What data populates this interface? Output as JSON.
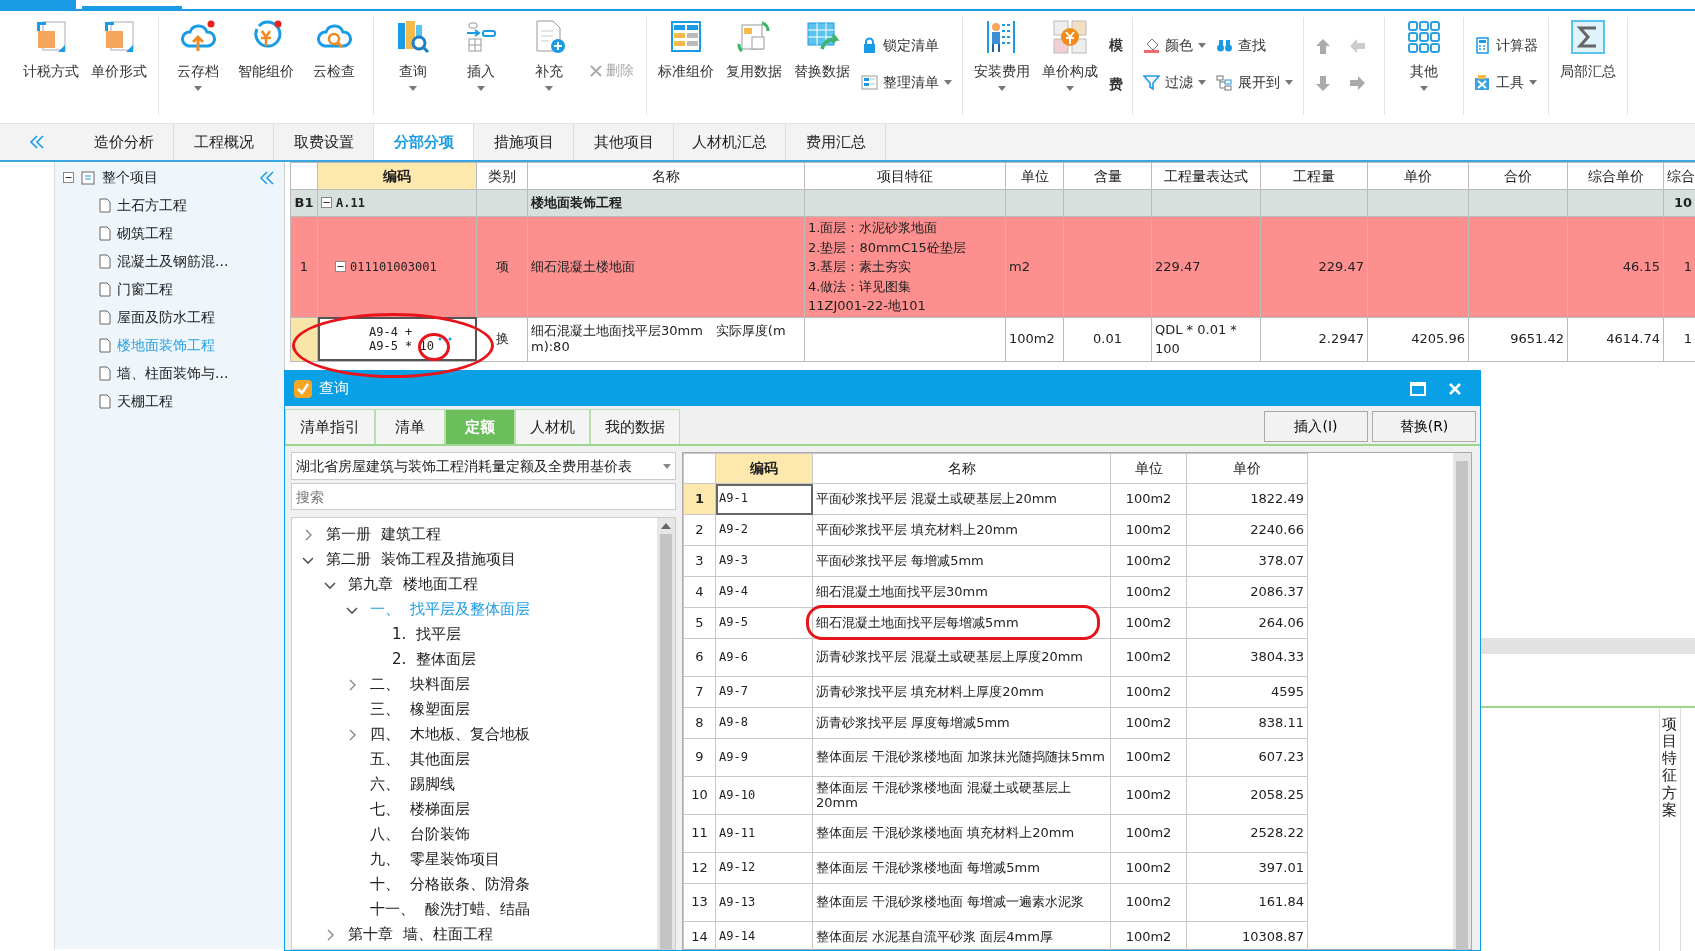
{
  "ribbon": [
    {
      "items": [
        {
          "kind": "big",
          "label": "计税方式"
        },
        {
          "kind": "big",
          "label": "单价形式"
        }
      ]
    },
    {
      "items": [
        {
          "kind": "big",
          "label": "云存档",
          "dropdown": true
        },
        {
          "kind": "big",
          "label": "智能组价"
        },
        {
          "kind": "big",
          "label": "云检查"
        }
      ]
    },
    {
      "items": [
        {
          "kind": "big",
          "label": "查询",
          "dropdown": true
        },
        {
          "kind": "big",
          "label": "插入",
          "dropdown": true
        },
        {
          "kind": "big",
          "label": "补充",
          "dropdown": true
        },
        {
          "kind": "small",
          "label": "删除",
          "disabled": true
        }
      ]
    },
    {
      "items": [
        {
          "kind": "big",
          "label": "标准组价"
        },
        {
          "kind": "big",
          "label": "复用数据"
        },
        {
          "kind": "big",
          "label": "替换数据"
        },
        {
          "kind": "stack",
          "entries": [
            {
              "label": "锁定清单"
            },
            {
              "label": "整理清单",
              "dropdown": true
            }
          ]
        }
      ]
    },
    {
      "items": [
        {
          "kind": "big",
          "label": "安装费用",
          "dropdown": true
        },
        {
          "kind": "big",
          "label": "单价构成",
          "dropdown": true
        },
        {
          "kind": "badges",
          "entries": [
            {
              "label": "模"
            },
            {
              "label": "费"
            }
          ]
        }
      ]
    },
    {
      "items": [
        {
          "kind": "stack",
          "entries": [
            {
              "label": "颜色",
              "dropdown": true
            },
            {
              "label": "过滤",
              "dropdown": true
            }
          ]
        },
        {
          "kind": "stack",
          "entries": [
            {
              "label": "查找"
            },
            {
              "label": "展开到",
              "dropdown": true
            }
          ]
        }
      ]
    },
    {
      "items": [
        {
          "kind": "arrows"
        }
      ]
    },
    {
      "items": [
        {
          "kind": "big",
          "label": "其他",
          "dropdown": true
        }
      ]
    },
    {
      "items": [
        {
          "kind": "stack",
          "entries": [
            {
              "label": "计算器"
            },
            {
              "label": "工具",
              "dropdown": true
            }
          ]
        }
      ]
    },
    {
      "items": [
        {
          "kind": "big",
          "label": "局部汇总"
        }
      ]
    }
  ],
  "tabs": [
    {
      "label": "造价分析",
      "selected": false
    },
    {
      "label": "工程概况",
      "selected": false
    },
    {
      "label": "取费设置",
      "selected": false
    },
    {
      "label": "分部分项",
      "selected": true
    },
    {
      "label": "措施项目",
      "selected": false
    },
    {
      "label": "其他项目",
      "selected": false
    },
    {
      "label": "人材机汇总",
      "selected": false
    },
    {
      "label": "费用汇总",
      "selected": false
    }
  ],
  "project_tree": {
    "label": "整个项目",
    "expanded": true,
    "children": [
      {
        "label": "土石方工程",
        "selected": false
      },
      {
        "label": "砌筑工程",
        "selected": false
      },
      {
        "label": "混凝土及钢筋混...",
        "selected": false
      },
      {
        "label": "门窗工程",
        "selected": false
      },
      {
        "label": "屋面及防水工程",
        "selected": false
      },
      {
        "label": "楼地面装饰工程",
        "selected": true
      },
      {
        "label": "墙、柱面装饰与...",
        "selected": false
      },
      {
        "label": "天棚工程",
        "selected": false
      }
    ]
  },
  "grid": {
    "columns": [
      {
        "label": "编码",
        "selected": true
      },
      {
        "label": "类别",
        "selected": false
      },
      {
        "label": "名称",
        "selected": false
      },
      {
        "label": "项目特征",
        "selected": false
      },
      {
        "label": "单位",
        "selected": false
      },
      {
        "label": "含量",
        "selected": false
      },
      {
        "label": "工程量表达式",
        "selected": false
      },
      {
        "label": "工程量",
        "selected": false
      },
      {
        "label": "单价",
        "selected": false
      },
      {
        "label": "合价",
        "selected": false
      },
      {
        "label": "综合单价",
        "selected": false
      },
      {
        "label": "综合",
        "selected": false
      }
    ],
    "rows": [
      {
        "kind": "section",
        "row_header": "B1",
        "expanded": true,
        "selected": false,
        "cells": [
          "A.11",
          null,
          "楼地面装饰工程",
          null,
          null,
          null,
          null,
          null,
          null,
          null,
          null,
          "10"
        ]
      },
      {
        "kind": "item",
        "row_header": "1",
        "expanded": true,
        "selected": false,
        "cells": [
          "011101003001",
          "项",
          "细石混凝土楼地面",
          "1.面层：水泥砂浆地面\n2.垫层：80mmC15砼垫层\n3.基层：素土夯实\n4.做法：详见图集\n11ZJ001-22-地101",
          "m2",
          null,
          "229.47",
          "229.47",
          null,
          null,
          "46.15",
          "1"
        ]
      },
      {
        "kind": "sub",
        "selected": true,
        "cells": [
          "A9-4 +\nA9-5 * 10",
          "换",
          "细石混凝土地面找平层30mm　实际厚度(mm):80",
          null,
          "100m2",
          "0.01",
          "QDL * 0.01 *\n100",
          "2.2947",
          "4205.96",
          "9651.42",
          "4614.74",
          "1"
        ]
      }
    ]
  },
  "side_panel": {
    "tab": "项目特征方案"
  },
  "dialog": {
    "title": "查询",
    "tabs": [
      {
        "label": "清单指引",
        "selected": false
      },
      {
        "label": "清单",
        "selected": false
      },
      {
        "label": "定额",
        "selected": true
      },
      {
        "label": "人材机",
        "selected": false
      },
      {
        "label": "我的数据",
        "selected": false
      }
    ],
    "buttons": [
      "插入(I)",
      "替换(R)"
    ],
    "library": "湖北省房屋建筑与装饰工程消耗量定额及全费用基价表",
    "search": {
      "placeholder": "搜索"
    },
    "tree": [
      {
        "label": "第一册  建筑工程",
        "expanded": false,
        "selected": false
      },
      {
        "label": "第二册  装饰工程及措施项目",
        "expanded": true,
        "selected": false,
        "children": [
          {
            "label": "第九章  楼地面工程",
            "expanded": true,
            "selected": false,
            "children": [
              {
                "label": "一、  找平层及整体面层",
                "expanded": true,
                "selected": true,
                "children": [
                  {
                    "label": "1.  找平层",
                    "selected": false
                  },
                  {
                    "label": "2.  整体面层",
                    "selected": false
                  }
                ]
              },
              {
                "label": "二、  块料面层",
                "expanded": false,
                "selected": false
              },
              {
                "label": "三、  橡塑面层",
                "selected": false
              },
              {
                "label": "四、  木地板、复合地板",
                "expanded": false,
                "selected": false
              },
              {
                "label": "五、  其他面层",
                "selected": false
              },
              {
                "label": "六、  踢脚线",
                "selected": false
              },
              {
                "label": "七、  楼梯面层",
                "selected": false
              },
              {
                "label": "八、  台阶装饰",
                "selected": false
              },
              {
                "label": "九、  零星装饰项目",
                "selected": false
              },
              {
                "label": "十、  分格嵌条、防滑条",
                "selected": false
              },
              {
                "label": "十一、  酸洗打蜡、结晶",
                "selected": false
              }
            ]
          },
          {
            "label": "第十章  墙、柱面工程",
            "expanded": false,
            "selected": false
          }
        ]
      }
    ],
    "columns": [
      {
        "label": "编码",
        "selected": true
      },
      {
        "label": "名称",
        "selected": false
      },
      {
        "label": "单位",
        "selected": false
      },
      {
        "label": "单价",
        "selected": false
      }
    ],
    "rows": [
      {
        "num": "1",
        "code": "A9-1",
        "name": "平面砂浆找平层 混凝土或硬基层上20mm",
        "unit": "100m2",
        "price": "1822.49",
        "selected": true
      },
      {
        "num": "2",
        "code": "A9-2",
        "name": "平面砂浆找平层 填充材料上20mm",
        "unit": "100m2",
        "price": "2240.66",
        "selected": false
      },
      {
        "num": "3",
        "code": "A9-3",
        "name": "平面砂浆找平层 每增减5mm",
        "unit": "100m2",
        "price": "378.07",
        "selected": false
      },
      {
        "num": "4",
        "code": "A9-4",
        "name": "细石混凝土地面找平层30mm",
        "unit": "100m2",
        "price": "2086.37",
        "selected": false
      },
      {
        "num": "5",
        "code": "A9-5",
        "name": "细石混凝土地面找平层每增减5mm",
        "unit": "100m2",
        "price": "264.06",
        "selected": false
      },
      {
        "num": "6",
        "code": "A9-6",
        "name": "沥青砂浆找平层 混凝土或硬基层上厚度20mm",
        "unit": "100m2",
        "price": "3804.33",
        "selected": false
      },
      {
        "num": "7",
        "code": "A9-7",
        "name": "沥青砂浆找平层 填充材料上厚度20mm",
        "unit": "100m2",
        "price": "4595",
        "selected": false
      },
      {
        "num": "8",
        "code": "A9-8",
        "name": "沥青砂浆找平层 厚度每增减5mm",
        "unit": "100m2",
        "price": "838.11",
        "selected": false
      },
      {
        "num": "9",
        "code": "A9-9",
        "name": "整体面层 干混砂浆楼地面 加浆抹光随捣随抹5mm",
        "unit": "100m2",
        "price": "607.23",
        "selected": false
      },
      {
        "num": "10",
        "code": "A9-10",
        "name": "整体面层 干混砂浆楼地面 混凝土或硬基层上20mm",
        "unit": "100m2",
        "price": "2058.25",
        "selected": false
      },
      {
        "num": "11",
        "code": "A9-11",
        "name": "整体面层 干混砂浆楼地面 填充材料上20mm",
        "unit": "100m2",
        "price": "2528.22",
        "selected": false
      },
      {
        "num": "12",
        "code": "A9-12",
        "name": "整体面层 干混砂浆楼地面 每增减5mm",
        "unit": "100m2",
        "price": "397.01",
        "selected": false
      },
      {
        "num": "13",
        "code": "A9-13",
        "name": "整体面层 干混砂浆楼地面 每增减一遍素水泥浆",
        "unit": "100m2",
        "price": "161.84",
        "selected": false
      },
      {
        "num": "14",
        "code": "A9-14",
        "name": "整体面层 水泥基自流平砂浆 面层4mm厚",
        "unit": "100m2",
        "price": "10308.87",
        "selected": false
      }
    ]
  }
}
